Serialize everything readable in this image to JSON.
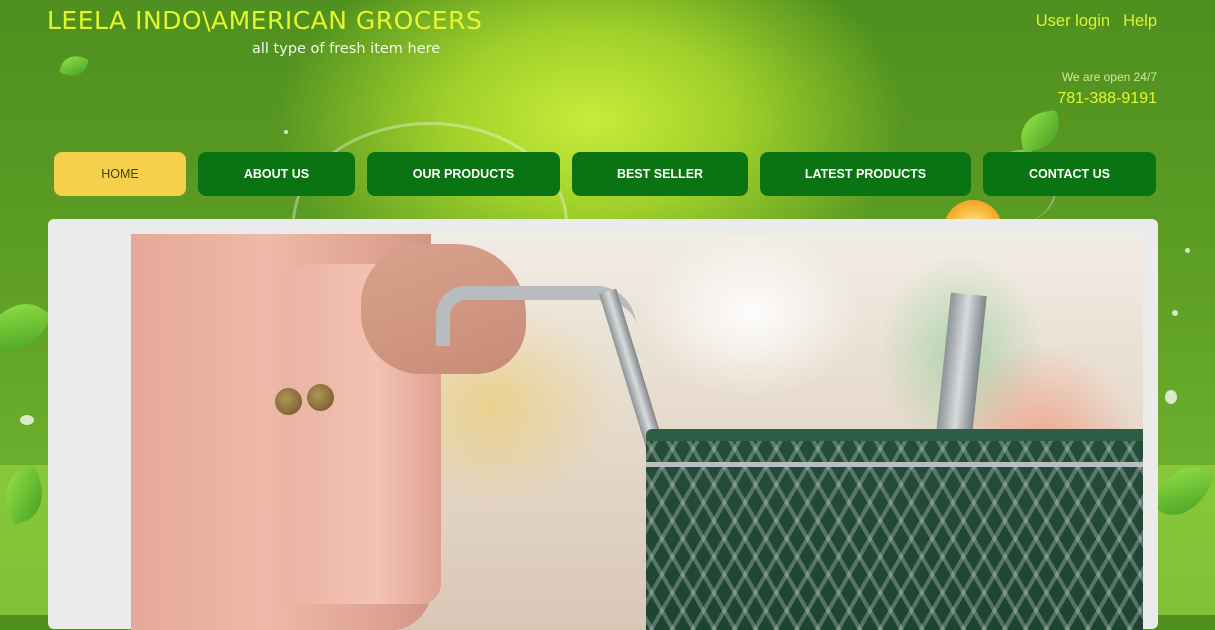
{
  "header": {
    "title": "LEELA INDO\\AMERICAN GROCERS",
    "tagline": "all type of fresh item here",
    "links": [
      "User login",
      "Help"
    ],
    "open_note": "We are open 24/7",
    "phone": "781-388-9191"
  },
  "nav": {
    "items": [
      {
        "label": "HOME",
        "active": true
      },
      {
        "label": "ABOUT US",
        "active": false
      },
      {
        "label": "OUR PRODUCTS",
        "active": false
      },
      {
        "label": "BEST SELLER",
        "active": false
      },
      {
        "label": "LATEST PRODUCTS",
        "active": false
      },
      {
        "label": "CONTACT US",
        "active": false
      }
    ]
  },
  "hero": {
    "image": "shopping-cart-photo"
  },
  "colors": {
    "background_green": "#5e9f24",
    "brand_yellow": "#e4f72c",
    "nav_green": "#0b7412",
    "nav_active": "#f6cf4b",
    "panel": "#ebebeb"
  }
}
